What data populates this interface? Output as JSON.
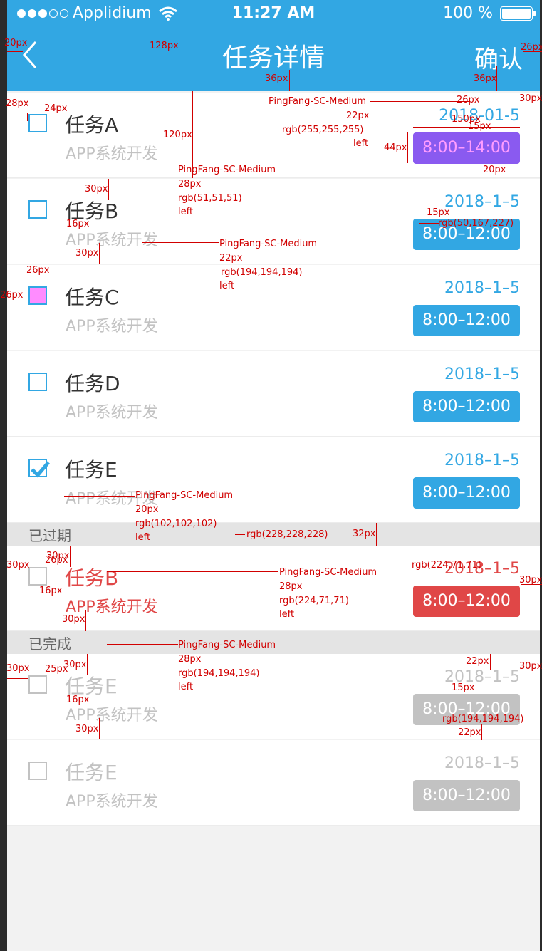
{
  "status": {
    "carrier": "Applidium",
    "time": "11:27 AM",
    "battery": "100 %"
  },
  "nav": {
    "title": "任务详情",
    "confirm": "确认"
  },
  "tasks": [
    {
      "name": "任务A",
      "sub": "APP系统开发",
      "date": "2018-01-5",
      "time": "8:00–14:00"
    },
    {
      "name": "任务B",
      "sub": "APP系统开发",
      "date": "2018–1–5",
      "time": "8:00–12:00"
    },
    {
      "name": "任务C",
      "sub": "APP系统开发",
      "date": "2018–1–5",
      "time": "8:00–12:00"
    },
    {
      "name": "任务D",
      "sub": "APP系统开发",
      "date": "2018–1–5",
      "time": "8:00–12:00"
    },
    {
      "name": "任务E",
      "sub": "APP系统开发",
      "date": "2018–1–5",
      "time": "8:00–12:00"
    }
  ],
  "expired": {
    "label": "已过期",
    "tasks": [
      {
        "name": "任务B",
        "sub": "APP系统开发",
        "date": "2018–1–5",
        "time": "8:00–12:00"
      }
    ]
  },
  "done": {
    "label": "已完成",
    "tasks": [
      {
        "name": "任务E",
        "sub": "APP系统开发",
        "date": "2018–1–5",
        "time": "8:00–12:00"
      },
      {
        "name": "任务E",
        "sub": "APP系统开发",
        "date": "2018–1–5",
        "time": "8:00–12:00"
      }
    ]
  },
  "annotations": {
    "a1": "20px",
    "a2": "128px",
    "a3": "36px",
    "a4": "36px",
    "a5": "26px",
    "a6": "PingFang-SC-Medium",
    "a7": "22px",
    "a8": "rgb(255,255,255)",
    "a9": "left",
    "a10": "28px",
    "a11": "24px",
    "a12": "120px",
    "a13": "26px",
    "a14": "30px",
    "a15": "150px",
    "a16": "15px",
    "a17": "44px",
    "a18": "20px",
    "a19": "PingFang-SC-Medium",
    "a20": "28px",
    "a21": "rgb(51,51,51)",
    "a22": "left",
    "a23": "30px",
    "a24": "16px",
    "a25": "30px",
    "a26": "PingFang-SC-Medium",
    "a27": "22px",
    "a28": "rgb(194,194,194)",
    "a29": "left",
    "a30": "15px",
    "a31": "rgb(50,167,227)",
    "a32": "26px",
    "a33": "26px",
    "a34": "PingFang-SC-Medium",
    "a35": "20px",
    "a36": "rgb(102,102,102)",
    "a37": "left",
    "a38": "rgb(228,228,228)",
    "a39": "32px",
    "a40": "30px",
    "a41": "26px",
    "a42": "30px",
    "a43": "16px",
    "a44": "30px",
    "a45": "PingFang-SC-Medium",
    "a46": "28px",
    "a47": "rgb(224,71,71)",
    "a48": "left",
    "a49": "rgb(224,71,71)",
    "a50": "30px",
    "a51": "PingFang-SC-Medium",
    "a52": "28px",
    "a53": "rgb(194,194,194)",
    "a54": "left",
    "a55": "30px",
    "a56": "25px",
    "a57": "30px",
    "a58": "16px",
    "a59": "30px",
    "a60": "22px",
    "a61": "15px",
    "a62": "rgb(194,194,194)",
    "a63": "22px",
    "a64": "30px"
  },
  "colors": {
    "primary": "#32a7e3",
    "expired": "#e04747",
    "muted": "#c2c2c2",
    "text": "#333333"
  }
}
